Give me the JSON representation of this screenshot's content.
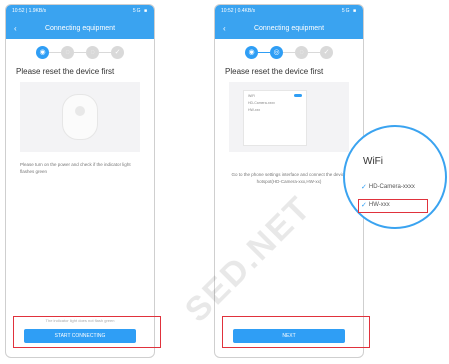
{
  "left": {
    "status": {
      "time": "10:52 | 1.9KB/s",
      "right": "5G ■"
    },
    "header_title": "Connecting equipment",
    "reset_title": "Please reset the device first",
    "instruction": "Please turn on the power and check if the indicator light flashes green",
    "hint": "The indicator light does not flash green",
    "button_label": "START CONNECTING"
  },
  "right": {
    "status": {
      "time": "10:52 | 0.4KB/s",
      "right": "5G ■"
    },
    "header_title": "Connecting equipment",
    "reset_title": "Please reset the device first",
    "mini_wifi": "WiFi",
    "mini_net1": "HD-Camera-xxxx",
    "mini_net2": "HW-xxx",
    "instruction": "Go to the phone settings interface and connect the device hotspot(HD-Camera-xxx,HW-xx)",
    "button_label": "NEXT"
  },
  "magnifier": {
    "title": "WiFi",
    "items": [
      "HD-Camera-xxxx",
      "HW-xxx"
    ]
  },
  "watermark": "SED.NET",
  "colors": {
    "accent": "#3aa3f0",
    "highlight": "#e0323c"
  }
}
